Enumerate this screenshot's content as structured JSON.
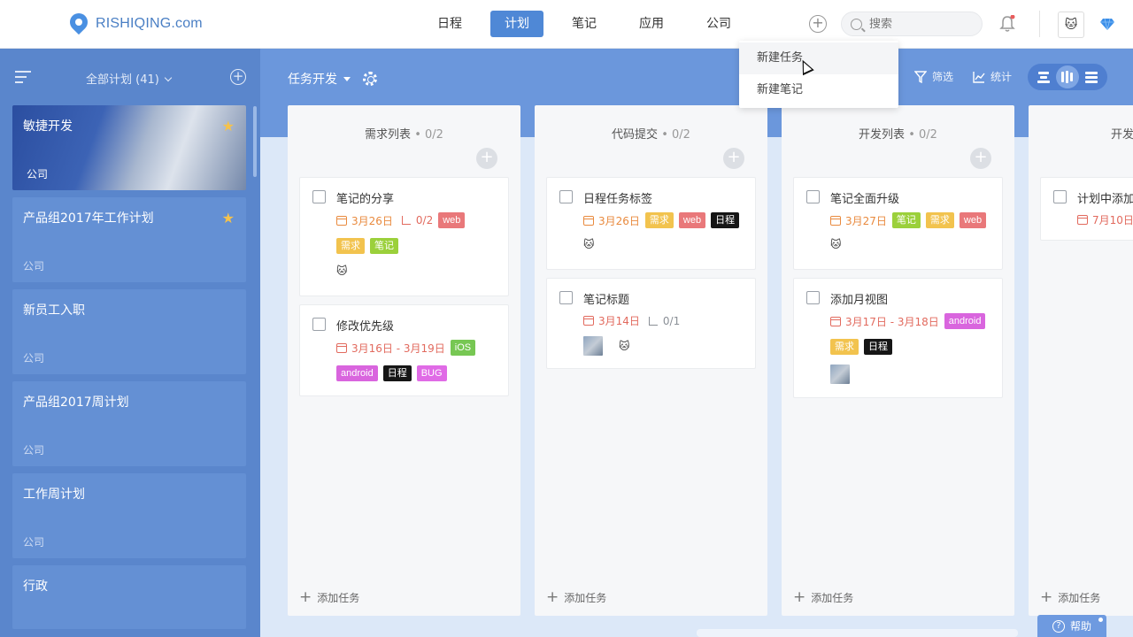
{
  "brand": {
    "logo_text": "RISHIQING.com"
  },
  "nav": {
    "items": [
      "日程",
      "计划",
      "笔记",
      "应用",
      "公司"
    ],
    "active": "计划"
  },
  "search": {
    "placeholder": "搜索"
  },
  "sidebar": {
    "title": "全部计划 (41)",
    "plans": [
      {
        "name": "敏捷开发",
        "org": "公司",
        "starred": true
      },
      {
        "name": "产品组2017年工作计划",
        "org": "公司",
        "starred": true
      },
      {
        "name": "新员工入职",
        "org": "公司",
        "starred": false
      },
      {
        "name": "产品组2017周计划",
        "org": "公司",
        "starred": false
      },
      {
        "name": "工作周计划",
        "org": "公司",
        "starred": false
      },
      {
        "name": "行政",
        "org": "",
        "starred": false
      }
    ]
  },
  "board": {
    "title": "任务开发",
    "tools": {
      "filter": "筛选",
      "stats": "统计"
    },
    "add_task_label": "添加任务",
    "columns": [
      {
        "title": "需求列表",
        "count": "• 0/2",
        "cards": [
          {
            "title": "笔记的分享",
            "date": "3月26日",
            "subtasks": "0/2",
            "tags": [
              "web",
              "需求",
              "笔记"
            ]
          },
          {
            "title": "修改优先级",
            "date": "3月16日 - 3月19日",
            "tags": [
              "iOS",
              "android",
              "日程",
              "BUG"
            ]
          }
        ]
      },
      {
        "title": "代码提交",
        "count": "• 0/2",
        "cards": [
          {
            "title": "日程任务标签",
            "date": "3月26日",
            "tags": [
              "需求",
              "web",
              "日程"
            ]
          },
          {
            "title": "笔记标题",
            "date": "3月14日",
            "subtasks": "0/1",
            "tags": []
          }
        ]
      },
      {
        "title": "开发列表",
        "count": "• 0/2",
        "cards": [
          {
            "title": "笔记全面升级",
            "date": "3月27日",
            "tags": [
              "笔记",
              "需求",
              "web"
            ]
          },
          {
            "title": "添加月视图",
            "date": "3月17日 - 3月18日",
            "tags": [
              "android",
              "需求",
              "日程"
            ]
          }
        ]
      },
      {
        "title": "开发",
        "cards": [
          {
            "title": "计划中添加",
            "date": "7月10日",
            "tags": []
          }
        ]
      }
    ]
  },
  "dropdown": {
    "items": [
      "新建任务",
      "新建笔记"
    ]
  },
  "help": {
    "label": "帮助"
  },
  "icons": {
    "avatar": "cat-avatar-icon",
    "cat": "🐱"
  },
  "colors": {
    "accent": "#4f88d6",
    "sidebar": "#5a86cc",
    "tag_web": "#e9787a",
    "tag_req": "#f2c34e",
    "tag_note": "#9bd03b",
    "tag_android": "#d965de"
  }
}
